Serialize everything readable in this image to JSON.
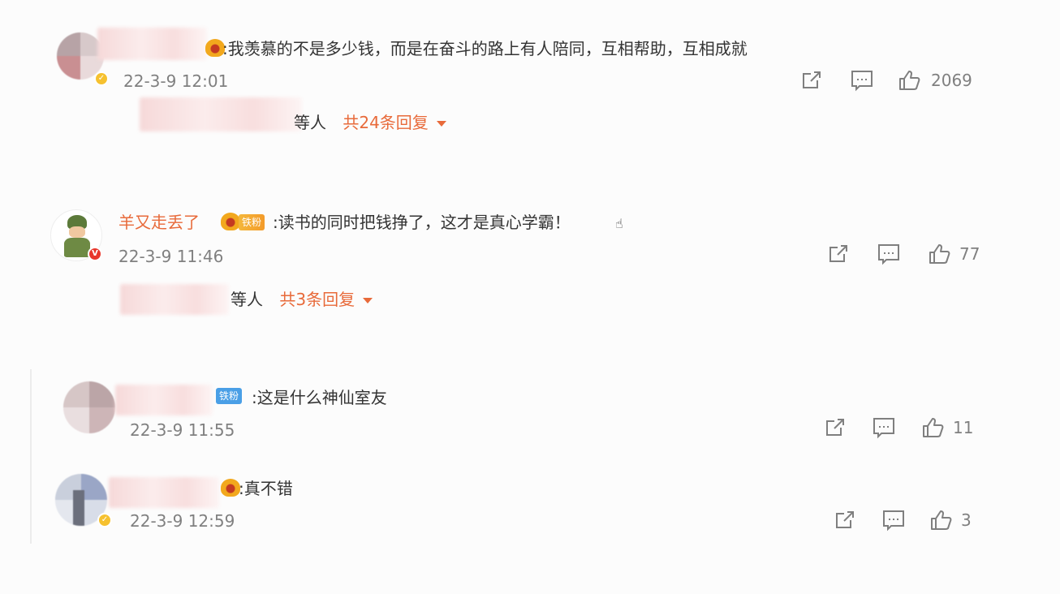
{
  "comments": [
    {
      "username": "",
      "text": ":我羡慕的不是多少钱，而是在奋斗的路上有人陪同，互相帮助，互相成就",
      "time": "22-3-9 12:01",
      "likes": "2069",
      "replies_prefix": "等人",
      "replies_link": "共24条回复"
    },
    {
      "username": "羊又走丢了",
      "tag": "铁粉",
      "text": ":读书的同时把钱挣了，这才是真心学霸！",
      "time": "22-3-9 11:46",
      "likes": "77",
      "replies_prefix": "等人",
      "replies_link": "共3条回复"
    }
  ],
  "replies": [
    {
      "tag": "铁粉",
      "text": ":这是什么神仙室友",
      "time": "22-3-9 11:55",
      "likes": "11"
    },
    {
      "text": ":真不错",
      "time": "22-3-9 12:59",
      "likes": "3"
    }
  ],
  "colors": {
    "link_orange": "#e86a3a",
    "meta_gray": "#808080",
    "text_dark": "#333333"
  },
  "icons": [
    "share-icon",
    "comment-icon",
    "like-icon",
    "caret-down-icon",
    "verified-badge-icon",
    "crown-badge-icon"
  ]
}
